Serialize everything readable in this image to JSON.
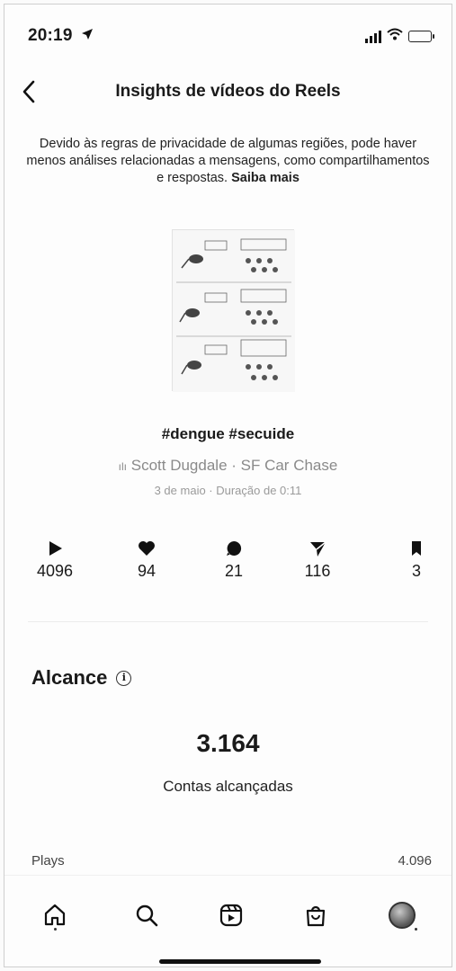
{
  "status_bar": {
    "time": "20:19",
    "icons": [
      "location-arrow-icon",
      "signal-bars-icon",
      "wifi-icon",
      "battery-icon"
    ]
  },
  "header": {
    "title": "Insights de vídeos do Reels",
    "back_icon": "chevron-left-icon"
  },
  "notice": {
    "text": "Devido às regras de privacidade de algumas regiões, pode haver menos análises relacionadas a mensagens, como compartilhamentos e respostas.",
    "link": "Saiba mais"
  },
  "reel": {
    "caption": "#dengue #secuide",
    "audio": "Scott Dugdale · SF Car Chase",
    "meta": "3 de maio · Duração de 0:11"
  },
  "stats": [
    {
      "icon": "play-icon",
      "value": "4096"
    },
    {
      "icon": "heart-icon",
      "value": "94"
    },
    {
      "icon": "comment-icon",
      "value": "21"
    },
    {
      "icon": "share-icon",
      "value": "116"
    },
    {
      "icon": "bookmark-icon",
      "value": "3"
    }
  ],
  "reach": {
    "title": "Alcance",
    "value": "3.164",
    "label": "Contas alcançadas"
  },
  "plays_row": {
    "label": "Plays",
    "value": "4.096"
  },
  "tab_bar": {
    "icons": [
      "home-icon",
      "search-icon",
      "reels-icon",
      "shop-icon",
      "profile-avatar"
    ]
  }
}
